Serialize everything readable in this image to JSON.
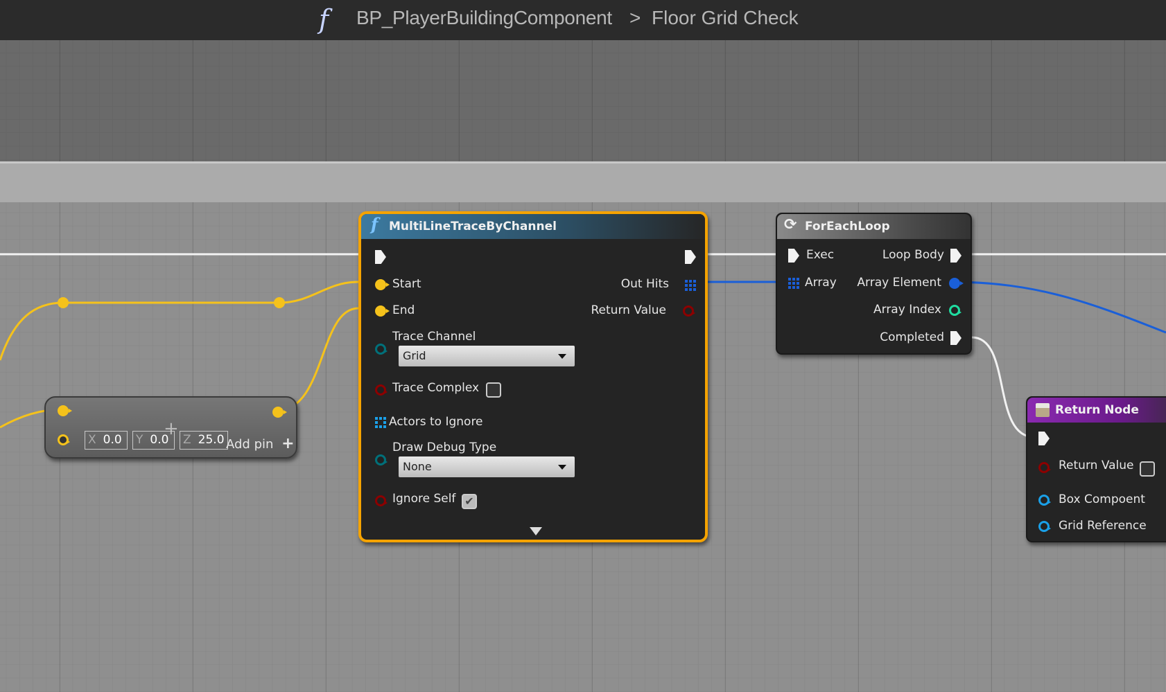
{
  "header": {
    "icon": "function-icon",
    "owner": "BP_PlayerBuildingComponent",
    "separator": ">",
    "graph": "Floor Grid Check"
  },
  "colors": {
    "exec": "#f2f2f2",
    "vector": "#f5c21b",
    "bool": "#8c0000",
    "array_blue": "#1a5fd8",
    "byte": "#00707a",
    "int": "#1fdca0",
    "object": "#1aa0e8",
    "selected": "#f5a300",
    "return_header": "#7a1c9e"
  },
  "reroute": {
    "x_label": "X",
    "x": "0.0",
    "y_label": "Y",
    "y": "0.0",
    "z_label": "Z",
    "z": "25.0",
    "add_pin": "Add pin",
    "add_icon": "+"
  },
  "trace": {
    "title": "MultiLineTraceByChannel",
    "start": "Start",
    "end": "End",
    "out_hits": "Out Hits",
    "return_value": "Return Value",
    "trace_channel": "Trace Channel",
    "trace_channel_value": "Grid",
    "trace_complex": "Trace Complex",
    "trace_complex_checked": false,
    "actors_to_ignore": "Actors to Ignore",
    "draw_debug_type": "Draw Debug Type",
    "draw_debug_value": "None",
    "ignore_self": "Ignore Self",
    "ignore_self_checked": true
  },
  "foreach": {
    "title": "ForEachLoop",
    "exec": "Exec",
    "loop_body": "Loop Body",
    "array": "Array",
    "array_element": "Array Element",
    "array_index": "Array Index",
    "completed": "Completed"
  },
  "return_node": {
    "title": "Return Node",
    "return_value": "Return Value",
    "return_value_checked": false,
    "box": "Box Compoent",
    "grid": "Grid Reference"
  }
}
